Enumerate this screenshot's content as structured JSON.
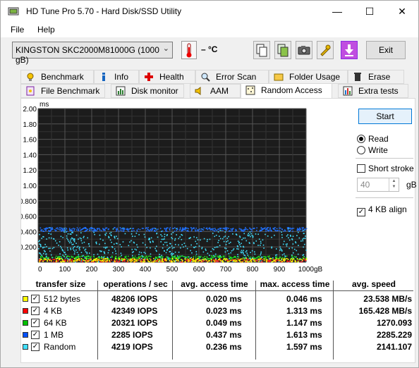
{
  "window": {
    "title": "HD Tune Pro 5.70 - Hard Disk/SSD Utility",
    "minimize": "—",
    "maximize": "☐",
    "close": "✕"
  },
  "menu": {
    "file": "File",
    "help": "Help"
  },
  "toolbar": {
    "drive": "KINGSTON SKC2000M81000G (1000 gB)",
    "temperature": "– °C",
    "exit_label": "Exit"
  },
  "tabs_top": [
    {
      "label": "Benchmark"
    },
    {
      "label": "Info"
    },
    {
      "label": "Health"
    },
    {
      "label": "Error Scan"
    },
    {
      "label": "Folder Usage"
    },
    {
      "label": "Erase"
    }
  ],
  "tabs_bottom": [
    {
      "label": "File Benchmark"
    },
    {
      "label": "Disk monitor"
    },
    {
      "label": "AAM"
    },
    {
      "label": "Random Access"
    },
    {
      "label": "Extra tests"
    }
  ],
  "controls": {
    "start_label": "Start",
    "read_label": "Read",
    "write_label": "Write",
    "short_stroke_label": "Short stroke",
    "stroke_value": "40",
    "stroke_unit": "gB",
    "align_label": "4 KB align"
  },
  "chart_data": {
    "type": "scatter",
    "ylabel": "ms",
    "xlabel": "gB",
    "ylim": [
      0,
      2.0
    ],
    "xlim": [
      0,
      1000
    ],
    "y_ticks": [
      "2.00",
      "1.80",
      "1.60",
      "1.40",
      "1.20",
      "1.00",
      "0.800",
      "0.600",
      "0.400",
      "0.200"
    ],
    "x_ticks": [
      "0",
      "100",
      "200",
      "300",
      "400",
      "500",
      "600",
      "700",
      "800",
      "900",
      "1000gB"
    ],
    "background": "#1c1c1c",
    "series": [
      {
        "name": "512 bytes",
        "color": "#ffff00",
        "band": [
          0.0,
          0.05
        ]
      },
      {
        "name": "4 KB",
        "color": "#ff2020",
        "band": [
          0.0,
          0.04
        ]
      },
      {
        "name": "64 KB",
        "color": "#20e020",
        "band": [
          0.03,
          0.08
        ]
      },
      {
        "name": "1 MB",
        "color": "#2070ff",
        "band": [
          0.4,
          0.45
        ]
      },
      {
        "name": "Random",
        "color": "#40e0ff",
        "band": [
          0.0,
          0.45
        ]
      }
    ]
  },
  "table": {
    "headers": [
      "transfer size",
      "operations / sec",
      "avg. access time",
      "max. access time",
      "avg. speed"
    ],
    "rows": [
      {
        "color": "#ffff00",
        "size": "512 bytes",
        "ops": "48206 IOPS",
        "avg": "0.020 ms",
        "max": "0.046 ms",
        "speed": "23.538 MB/s"
      },
      {
        "color": "#ff0000",
        "size": "4 KB",
        "ops": "42349 IOPS",
        "avg": "0.023 ms",
        "max": "1.313 ms",
        "speed": "165.428 MB/s"
      },
      {
        "color": "#00c000",
        "size": "64 KB",
        "ops": "20321 IOPS",
        "avg": "0.049 ms",
        "max": "1.147 ms",
        "speed": "1270.093"
      },
      {
        "color": "#0050ff",
        "size": "1 MB",
        "ops": "2285 IOPS",
        "avg": "0.437 ms",
        "max": "1.613 ms",
        "speed": "2285.229"
      },
      {
        "color": "#40e0ff",
        "size": "Random",
        "ops": "4219 IOPS",
        "avg": "0.236 ms",
        "max": "1.597 ms",
        "speed": "2141.107"
      }
    ]
  }
}
